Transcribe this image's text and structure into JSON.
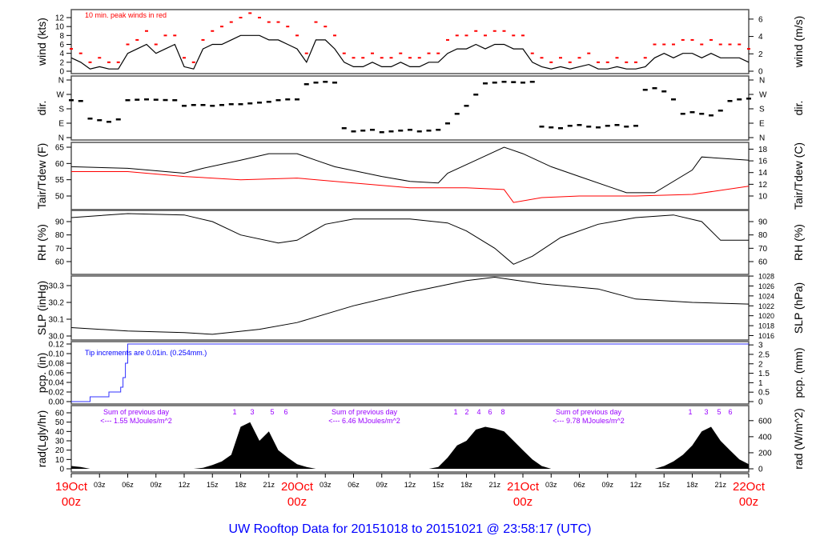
{
  "title": "UW Rooftop Data for 20151018  to  20151021 @ 23:58:17  (UTC)",
  "colors": {
    "title": "#0000ff",
    "peak": "#ff0000",
    "tdew": "#ff0000",
    "pcp": "#3333ff",
    "annotation": "#9900ff",
    "date": "#ff0000"
  },
  "chart_data": {
    "type": "line",
    "x_axis": {
      "start": "19Oct 00z",
      "step_hours": 1,
      "tick_labels": [
        "",
        "03z",
        "06z",
        "09z",
        "12z",
        "15z",
        "18z",
        "21z",
        "",
        "03z",
        "06z",
        "09z",
        "12z",
        "15z",
        "18z",
        "21z",
        "",
        "03z",
        "06z",
        "09z",
        "12z",
        "15z",
        "18z",
        "21z",
        ""
      ],
      "date_labels": [
        {
          "date": "19Oct",
          "hour": "00z"
        },
        {
          "date": "20Oct",
          "hour": "00z"
        },
        {
          "date": "21Oct",
          "hour": "00z"
        },
        {
          "date": "22Oct",
          "hour": "00z"
        }
      ]
    },
    "panels": {
      "wind": {
        "ylabel": "wind (kts)",
        "ylabel_right": "wind (m/s)",
        "yticks": [
          "0",
          "2",
          "4",
          "6",
          "8",
          "10",
          "12"
        ],
        "yticks_right": [
          "0",
          "2",
          "4",
          "6"
        ],
        "annotation": "10 min. peak winds in red",
        "mean": [
          3,
          2,
          0.5,
          1,
          0.5,
          0.5,
          4,
          5,
          6,
          4,
          5,
          6,
          1,
          0.5,
          5,
          6,
          6,
          7,
          8,
          8,
          8,
          7,
          7,
          6,
          5,
          2,
          7,
          7,
          5,
          2,
          1,
          1,
          2,
          1,
          1,
          2,
          1,
          1,
          2,
          2,
          4,
          5,
          5,
          6,
          5,
          6,
          6,
          5,
          5,
          2,
          1,
          0.5,
          1,
          0.5,
          1,
          1.5,
          0.5,
          0.5,
          1,
          0.5,
          0.5,
          1,
          3,
          4,
          3,
          4,
          4,
          3,
          4,
          3,
          3,
          3,
          2
        ],
        "peak": [
          5,
          4,
          2,
          3,
          2,
          2,
          6,
          7,
          9,
          6,
          8,
          8,
          3,
          2,
          7,
          9,
          10,
          11,
          12,
          13,
          12,
          11,
          11,
          10,
          8,
          4,
          11,
          10,
          8,
          4,
          3,
          3,
          4,
          3,
          3,
          4,
          3,
          3,
          4,
          4,
          7,
          8,
          8,
          9,
          8,
          9,
          9,
          8,
          8,
          4,
          3,
          2,
          3,
          2,
          3,
          4,
          2,
          2,
          3,
          2,
          2,
          3,
          6,
          6,
          6,
          7,
          7,
          6,
          7,
          6,
          6,
          6,
          5
        ]
      },
      "dir": {
        "ylabel": "dir.",
        "ylabel_right": "dir.",
        "yticks": [
          "N",
          "E",
          "S",
          "W",
          "N"
        ],
        "values": [
          235,
          230,
          120,
          110,
          100,
          115,
          235,
          238,
          240,
          238,
          236,
          235,
          200,
          205,
          205,
          200,
          205,
          210,
          210,
          215,
          220,
          225,
          235,
          240,
          240,
          335,
          345,
          350,
          345,
          60,
          40,
          45,
          50,
          35,
          40,
          45,
          50,
          40,
          45,
          50,
          90,
          150,
          200,
          270,
          340,
          345,
          350,
          348,
          345,
          350,
          70,
          65,
          60,
          75,
          80,
          70,
          65,
          75,
          80,
          70,
          75,
          300,
          310,
          290,
          240,
          150,
          160,
          150,
          140,
          170,
          230,
          240,
          245
        ]
      },
      "temp": {
        "ylabel": "Tair/Tdew (F)",
        "ylabel_right": "Tair/Tdew (C)",
        "yticks": [
          "50",
          "55",
          "60",
          "65"
        ],
        "yticks_right": [
          "10",
          "12",
          "14",
          "16",
          "18"
        ],
        "tair_points": [
          [
            "19Oct 00z",
            59
          ],
          [
            "19Oct 06z",
            58.5
          ],
          [
            "19Oct 12z",
            57
          ],
          [
            "19Oct 14z",
            58.5
          ],
          [
            "19Oct 18z",
            61
          ],
          [
            "19Oct 21z",
            63
          ],
          [
            "20Oct 00z",
            63
          ],
          [
            "20Oct 02z",
            61
          ],
          [
            "20Oct 04z",
            59
          ],
          [
            "20Oct 09z",
            56
          ],
          [
            "20Oct 12z",
            54.5
          ],
          [
            "20Oct 15z",
            54
          ],
          [
            "20Oct 16z",
            57
          ],
          [
            "20Oct 19z",
            61
          ],
          [
            "20Oct 22z",
            65
          ],
          [
            "21Oct 00z",
            63
          ],
          [
            "21Oct 03z",
            59
          ],
          [
            "21Oct 06z",
            56
          ],
          [
            "21Oct 11z",
            51
          ],
          [
            "21Oct 14z",
            51
          ],
          [
            "21Oct 18z",
            58
          ],
          [
            "21Oct 19z",
            62
          ],
          [
            "22Oct 00z",
            61
          ]
        ],
        "tdew_points": [
          [
            "19Oct 00z",
            57.5
          ],
          [
            "19Oct 06z",
            57.5
          ],
          [
            "19Oct 12z",
            56
          ],
          [
            "19Oct 18z",
            55
          ],
          [
            "20Oct 00z",
            55.5
          ],
          [
            "20Oct 06z",
            54
          ],
          [
            "20Oct 12z",
            52.5
          ],
          [
            "20Oct 18z",
            52.5
          ],
          [
            "20Oct 22z",
            52
          ],
          [
            "20Oct 23z",
            48
          ],
          [
            "21Oct 02z",
            49.5
          ],
          [
            "21Oct 06z",
            50
          ],
          [
            "21Oct 12z",
            50
          ],
          [
            "21Oct 18z",
            50.5
          ],
          [
            "22Oct 00z",
            53
          ]
        ]
      },
      "rh": {
        "ylabel": "RH (%)",
        "ylabel_right": "RH (%)",
        "yticks": [
          "60",
          "70",
          "80",
          "90"
        ],
        "points": [
          [
            "19Oct 00z",
            93
          ],
          [
            "19Oct 06z",
            96
          ],
          [
            "19Oct 12z",
            95
          ],
          [
            "19Oct 15z",
            90
          ],
          [
            "19Oct 18z",
            80
          ],
          [
            "19Oct 22z",
            74
          ],
          [
            "20Oct 00z",
            76
          ],
          [
            "20Oct 03z",
            88
          ],
          [
            "20Oct 06z",
            92
          ],
          [
            "20Oct 12z",
            92
          ],
          [
            "20Oct 16z",
            89
          ],
          [
            "20Oct 18z",
            83
          ],
          [
            "20Oct 21z",
            70
          ],
          [
            "20Oct 23z",
            58
          ],
          [
            "21Oct 01z",
            64
          ],
          [
            "21Oct 04z",
            78
          ],
          [
            "21Oct 08z",
            88
          ],
          [
            "21Oct 12z",
            93
          ],
          [
            "21Oct 16z",
            95
          ],
          [
            "21Oct 19z",
            90
          ],
          [
            "21Oct 21z",
            76
          ],
          [
            "22Oct 00z",
            76
          ]
        ]
      },
      "slp": {
        "ylabel": "SLP (inHg)",
        "ylabel_right": "SLP (hPa)",
        "yticks": [
          "30.0",
          "30.1",
          "30.2",
          "30.3"
        ],
        "yticks_right": [
          "1016",
          "1018",
          "1020",
          "1022",
          "1024",
          "1026",
          "1028"
        ],
        "points": [
          [
            "19Oct 00z",
            30.05
          ],
          [
            "19Oct 06z",
            30.03
          ],
          [
            "19Oct 12z",
            30.02
          ],
          [
            "19Oct 15z",
            30.01
          ],
          [
            "19Oct 20z",
            30.04
          ],
          [
            "20Oct 00z",
            30.08
          ],
          [
            "20Oct 06z",
            30.18
          ],
          [
            "20Oct 12z",
            30.26
          ],
          [
            "20Oct 18z",
            30.33
          ],
          [
            "20Oct 21z",
            30.35
          ],
          [
            "21Oct 02z",
            30.31
          ],
          [
            "21Oct 08z",
            30.28
          ],
          [
            "21Oct 12z",
            30.22
          ],
          [
            "21Oct 18z",
            30.2
          ],
          [
            "22Oct 00z",
            30.19
          ]
        ]
      },
      "pcp": {
        "ylabel": "pcp. (in)",
        "ylabel_right": "pcp. (mm)",
        "yticks": [
          "0.00",
          "0.02",
          "0.04",
          "0.06",
          "0.08",
          "0.10",
          "0.12"
        ],
        "yticks_right": [
          "0",
          "0.5",
          "1",
          "1.5",
          "2",
          "2.5",
          "3"
        ],
        "annotation": "Tip increments are 0.01in. (0.254mm.)",
        "points": [
          [
            "19Oct 00z",
            0
          ],
          [
            "19Oct 02z",
            0.01
          ],
          [
            "19Oct 04z",
            0.02
          ],
          [
            "19Oct 05z",
            0.03
          ],
          [
            "19Oct 05z",
            0.05
          ],
          [
            "19Oct 05z",
            0.08
          ],
          [
            "19Oct 06z",
            0.12
          ],
          [
            "22Oct 00z",
            0.12
          ]
        ]
      },
      "rad": {
        "ylabel": "rad(Lgly/hr)",
        "ylabel_right": "rad (W/m^2)",
        "yticks": [
          "0",
          "10",
          "20",
          "30",
          "40",
          "50",
          "60"
        ],
        "yticks_right": [
          "0",
          "200",
          "400",
          "600"
        ],
        "values": [
          3,
          2,
          0,
          0,
          0,
          0,
          0,
          0,
          0,
          0,
          0,
          0,
          0,
          0,
          1,
          4,
          8,
          15,
          45,
          50,
          30,
          40,
          20,
          12,
          5,
          2,
          0,
          0,
          0,
          0,
          0,
          0,
          0,
          0,
          0,
          0,
          0,
          0,
          0,
          2,
          12,
          25,
          30,
          42,
          45,
          43,
          40,
          30,
          20,
          10,
          3,
          0,
          0,
          0,
          0,
          0,
          0,
          0,
          0,
          0,
          0,
          0,
          0,
          3,
          8,
          15,
          25,
          40,
          45,
          30,
          20,
          10,
          5
        ],
        "daily_sums": [
          {
            "line1": "Sum of previous day",
            "line2": "<--- 1.55 MJoules/m^2",
            "markers": [
              "1",
              "3",
              "5",
              "6"
            ]
          },
          {
            "line1": "Sum of previous day",
            "line2": "<--- 6.46 MJoules/m^2",
            "markers": [
              "1",
              "2",
              "4",
              "6",
              "8"
            ]
          },
          {
            "line1": "Sum of previous day",
            "line2": "<--- 9.78 MJoules/m^2",
            "markers": [
              "1",
              "3",
              "5",
              "6"
            ]
          }
        ]
      }
    }
  }
}
